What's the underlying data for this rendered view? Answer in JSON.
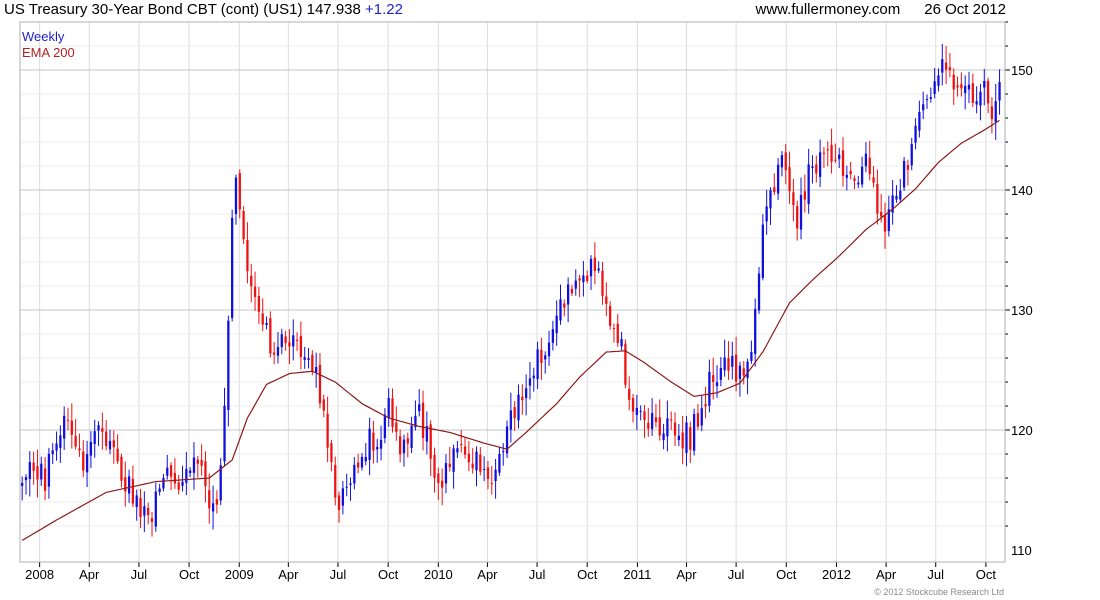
{
  "header": {
    "title": "US Treasury 30-Year  Bond CBT (cont) (US1) 147.938",
    "change": "+1.22",
    "site": "www.fullermoney.com",
    "date": "26 Oct 2012"
  },
  "legend": {
    "frequency": "Weekly",
    "ema": "EMA 200"
  },
  "footer": {
    "copyright": "© 2012 Stockcube Research Ltd"
  },
  "colors": {
    "up": "#1010dd",
    "down": "#ee1111",
    "ema": "#8b1a1a",
    "grid": "#dcdcdc"
  },
  "chart_data": {
    "type": "candlestick",
    "frequency": "weekly",
    "x_tick_labels": [
      "2008",
      "Apr",
      "Jul",
      "Oct",
      "2009",
      "Apr",
      "Jul",
      "Oct",
      "2010",
      "Apr",
      "Jul",
      "Oct",
      "2011",
      "Apr",
      "Jul",
      "Oct",
      "2012",
      "Apr",
      "Jul",
      "Oct"
    ],
    "y_ticks": [
      110,
      120,
      130,
      140,
      150
    ],
    "ylim": [
      109,
      154
    ],
    "grid": true,
    "price_anchors": [
      [
        "2007-11-30",
        115.5
      ],
      [
        "2007-12-21",
        117.5
      ],
      [
        "2008-01-11",
        116.0
      ],
      [
        "2008-01-25",
        119.0
      ],
      [
        "2008-02-15",
        120.5
      ],
      [
        "2008-03-07",
        119.5
      ],
      [
        "2008-03-21",
        116.5
      ],
      [
        "2008-04-11",
        119.0
      ],
      [
        "2008-04-25",
        120.0
      ],
      [
        "2008-05-09",
        118.5
      ],
      [
        "2008-06-06",
        116.0
      ],
      [
        "2008-06-27",
        114.5
      ],
      [
        "2008-07-18",
        112.5
      ],
      [
        "2008-08-08",
        115.0
      ],
      [
        "2008-08-29",
        117.0
      ],
      [
        "2008-09-19",
        115.5
      ],
      [
        "2008-10-10",
        118.5
      ],
      [
        "2008-10-24",
        117.0
      ],
      [
        "2008-11-07",
        114.0
      ],
      [
        "2008-11-21",
        114.5
      ],
      [
        "2008-12-05",
        122.0
      ],
      [
        "2008-12-19",
        138.5
      ],
      [
        "2008-12-26",
        140.5
      ],
      [
        "2009-01-09",
        136.0
      ],
      [
        "2009-01-23",
        132.0
      ],
      [
        "2009-02-13",
        129.5
      ],
      [
        "2009-03-06",
        126.5
      ],
      [
        "2009-03-20",
        128.5
      ],
      [
        "2009-04-10",
        127.0
      ],
      [
        "2009-05-01",
        126.5
      ],
      [
        "2009-05-22",
        124.5
      ],
      [
        "2009-06-05",
        121.5
      ],
      [
        "2009-06-19",
        117.0
      ],
      [
        "2009-07-03",
        113.0
      ],
      [
        "2009-07-17",
        115.5
      ],
      [
        "2009-08-07",
        117.0
      ],
      [
        "2009-08-28",
        119.0
      ],
      [
        "2009-09-11",
        119.5
      ],
      [
        "2009-10-02",
        121.5
      ],
      [
        "2009-10-23",
        119.0
      ],
      [
        "2009-11-13",
        120.5
      ],
      [
        "2009-11-27",
        121.5
      ],
      [
        "2009-12-11",
        119.5
      ],
      [
        "2009-12-31",
        115.5
      ],
      [
        "2010-01-15",
        117.0
      ],
      [
        "2010-02-05",
        118.5
      ],
      [
        "2010-02-26",
        117.5
      ],
      [
        "2010-03-19",
        117.5
      ],
      [
        "2010-04-09",
        115.0
      ],
      [
        "2010-04-23",
        117.5
      ],
      [
        "2010-05-14",
        120.5
      ],
      [
        "2010-06-04",
        122.5
      ],
      [
        "2010-06-25",
        125.0
      ],
      [
        "2010-07-16",
        127.0
      ],
      [
        "2010-08-06",
        128.5
      ],
      [
        "2010-08-27",
        132.5
      ],
      [
        "2010-09-10",
        131.5
      ],
      [
        "2010-09-24",
        133.0
      ],
      [
        "2010-10-08",
        134.0
      ],
      [
        "2010-10-22",
        132.5
      ],
      [
        "2010-11-05",
        131.0
      ],
      [
        "2010-11-19",
        127.5
      ],
      [
        "2010-12-03",
        126.5
      ],
      [
        "2010-12-17",
        121.5
      ],
      [
        "2011-01-07",
        120.5
      ],
      [
        "2011-01-28",
        121.0
      ],
      [
        "2011-02-11",
        120.0
      ],
      [
        "2011-03-04",
        120.5
      ],
      [
        "2011-03-18",
        119.5
      ],
      [
        "2011-04-08",
        119.5
      ],
      [
        "2011-04-22",
        121.0
      ],
      [
        "2011-05-06",
        123.0
      ],
      [
        "2011-05-27",
        125.0
      ],
      [
        "2011-06-17",
        125.5
      ],
      [
        "2011-07-01",
        124.5
      ],
      [
        "2011-07-15",
        125.5
      ],
      [
        "2011-07-29",
        127.5
      ],
      [
        "2011-08-12",
        134.0
      ],
      [
        "2011-08-26",
        138.5
      ],
      [
        "2011-09-09",
        140.5
      ],
      [
        "2011-09-23",
        143.5
      ],
      [
        "2011-10-07",
        140.0
      ],
      [
        "2011-10-21",
        137.5
      ],
      [
        "2011-11-04",
        140.0
      ],
      [
        "2011-11-18",
        142.0
      ],
      [
        "2011-12-09",
        143.0
      ],
      [
        "2011-12-30",
        143.0
      ],
      [
        "2012-01-20",
        142.0
      ],
      [
        "2012-02-10",
        141.5
      ],
      [
        "2012-02-24",
        142.5
      ],
      [
        "2012-03-16",
        138.5
      ],
      [
        "2012-03-30",
        137.5
      ],
      [
        "2012-04-13",
        139.5
      ],
      [
        "2012-05-04",
        141.5
      ],
      [
        "2012-05-25",
        144.5
      ],
      [
        "2012-06-08",
        148.0
      ],
      [
        "2012-06-22",
        148.5
      ],
      [
        "2012-07-06",
        149.5
      ],
      [
        "2012-07-20",
        150.5
      ],
      [
        "2012-08-03",
        149.0
      ],
      [
        "2012-08-17",
        147.5
      ],
      [
        "2012-08-31",
        148.5
      ],
      [
        "2012-09-14",
        146.5
      ],
      [
        "2012-09-28",
        148.0
      ],
      [
        "2012-10-12",
        147.0
      ],
      [
        "2012-10-26",
        147.9
      ]
    ],
    "ema200_anchors": [
      [
        "2007-11-30",
        110.8
      ],
      [
        "2008-02-01",
        112.5
      ],
      [
        "2008-05-02",
        114.8
      ],
      [
        "2008-08-01",
        115.7
      ],
      [
        "2008-11-07",
        116.0
      ],
      [
        "2008-12-19",
        117.5
      ],
      [
        "2009-01-16",
        121.0
      ],
      [
        "2009-02-20",
        123.8
      ],
      [
        "2009-04-03",
        124.7
      ],
      [
        "2009-05-15",
        124.9
      ],
      [
        "2009-06-26",
        124.0
      ],
      [
        "2009-08-14",
        122.2
      ],
      [
        "2009-10-02",
        121.0
      ],
      [
        "2009-11-27",
        120.3
      ],
      [
        "2010-01-22",
        119.8
      ],
      [
        "2010-03-26",
        118.9
      ],
      [
        "2010-05-07",
        118.4
      ],
      [
        "2010-06-11",
        119.8
      ],
      [
        "2010-08-06",
        122.2
      ],
      [
        "2010-09-17",
        124.4
      ],
      [
        "2010-11-05",
        126.5
      ],
      [
        "2010-12-10",
        126.6
      ],
      [
        "2011-01-14",
        125.6
      ],
      [
        "2011-03-04",
        124.0
      ],
      [
        "2011-04-15",
        122.8
      ],
      [
        "2011-05-27",
        123.1
      ],
      [
        "2011-07-08",
        123.9
      ],
      [
        "2011-08-19",
        126.5
      ],
      [
        "2011-10-07",
        130.6
      ],
      [
        "2011-11-18",
        132.5
      ],
      [
        "2012-01-06",
        134.5
      ],
      [
        "2012-02-24",
        136.7
      ],
      [
        "2012-04-13",
        138.4
      ],
      [
        "2012-05-25",
        140.1
      ],
      [
        "2012-07-06",
        142.3
      ],
      [
        "2012-08-17",
        143.9
      ],
      [
        "2012-09-28",
        145.0
      ],
      [
        "2012-10-26",
        145.8
      ]
    ]
  }
}
